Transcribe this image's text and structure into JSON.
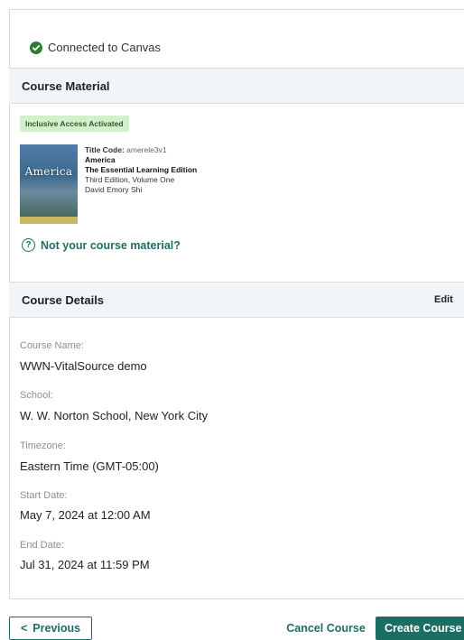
{
  "connection": {
    "status_text": "Connected to Canvas"
  },
  "course_material": {
    "header": "Course Material",
    "badge": "Inclusive Access Activated",
    "cover_title": "America",
    "book": {
      "title_code_label": "Title Code:",
      "title_code_value": "amerele3v1",
      "title": "America",
      "subtitle": "The Essential Learning Edition",
      "edition": "Third Edition, Volume One",
      "author": "David Emory Shi"
    },
    "not_your_material": "Not your course material?"
  },
  "course_details": {
    "header": "Course Details",
    "edit_label": "Edit",
    "fields": [
      {
        "label": "Course Name:",
        "value": "WWN-VitalSource demo"
      },
      {
        "label": "School:",
        "value": "W. W. Norton School, New York City"
      },
      {
        "label": "Timezone:",
        "value": "Eastern Time (GMT-05:00)"
      },
      {
        "label": "Start Date:",
        "value": "May 7, 2024 at 12:00 AM"
      },
      {
        "label": "End Date:",
        "value": "Jul 31, 2024 at 11:59 PM"
      }
    ]
  },
  "footer": {
    "previous_label": "Previous",
    "previous_icon": "<",
    "cancel_label": "Cancel Course",
    "create_label": "Create Course"
  },
  "colors": {
    "accent": "#1f6d65",
    "badge_bg": "#d3f0cc",
    "header_bg": "#f1f5f8",
    "success": "#2e7d32"
  }
}
